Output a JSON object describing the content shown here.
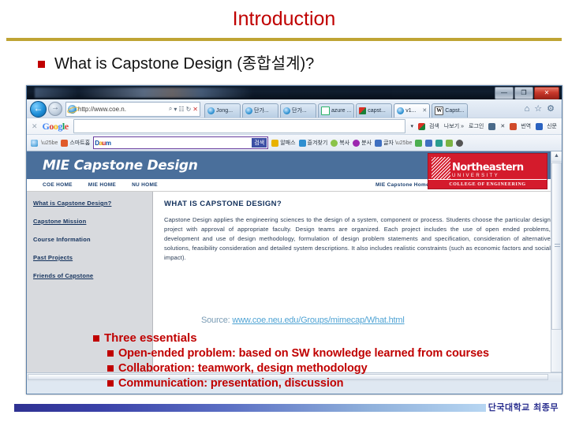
{
  "slide": {
    "title": "Introduction",
    "accent_rule_color": "#BFA434",
    "title_color": "#C00000",
    "main_bullet": "What is Capstone Design (종합설계)?"
  },
  "browser": {
    "window_title": "",
    "window_buttons": {
      "minimize": "—",
      "maximize": "❐",
      "close": "✕"
    },
    "back_icon": "←",
    "forward_icon": "→",
    "address": {
      "url": "http://www.coe.n.",
      "search_icon": "⌕",
      "dropdown_icon": "▾",
      "compat_icon": "☷",
      "refresh_icon": "↻",
      "stop_icon": "✕"
    },
    "tabs": [
      {
        "label": "Jong...",
        "icon": "ie-icon",
        "active": false,
        "closable": false
      },
      {
        "label": "단가...",
        "icon": "ie-icon",
        "active": false,
        "closable": false
      },
      {
        "label": "단가...",
        "icon": "ie-icon",
        "active": false,
        "closable": false
      },
      {
        "label": "azure ...",
        "icon": "window-icon",
        "active": false,
        "closable": false
      },
      {
        "label": "capst...",
        "icon": "google-icon",
        "active": false,
        "closable": false
      },
      {
        "label": "v1...",
        "icon": "ie-icon",
        "active": true,
        "closable": true
      },
      {
        "label": "Capst...",
        "icon": "wikipedia-icon",
        "active": false,
        "closable": false
      }
    ],
    "tab_close_glyph": "✕",
    "nav_icons": [
      {
        "name": "home-icon",
        "glyph": "⌂"
      },
      {
        "name": "favorites-star-icon",
        "glyph": "☆"
      },
      {
        "name": "settings-gear-icon",
        "glyph": "⚙"
      }
    ],
    "google_bar": {
      "close_glyph": "✕",
      "logo_letters": [
        "G",
        "o",
        "o",
        "g",
        "l",
        "e"
      ],
      "search_value": "",
      "search_placeholder": "",
      "dropdown_glyph": "▾",
      "items": [
        {
          "name": "search-menu",
          "label": "검색",
          "color": "#3a7bd5"
        },
        {
          "name": "more-menu",
          "label": "나보기 »",
          "color": "#888888"
        },
        {
          "name": "login-link",
          "label": "로그인",
          "color": "#666666"
        },
        {
          "name": "tools-menu",
          "label": "",
          "color": "#4a6a8a"
        },
        {
          "name": "close-x",
          "label": "✕",
          "color": "#777777"
        },
        {
          "name": "translate-menu",
          "label": "번역",
          "color": "#d04a2a"
        },
        {
          "name": "news-menu",
          "label": "신문",
          "color": "#2a62c0"
        }
      ]
    },
    "daum_bar": {
      "logo": [
        "D",
        "a",
        "u",
        "m"
      ],
      "home_label": "스마트홈",
      "search_value": "",
      "search_button": "검색",
      "items": [
        {
          "name": "alpass-item",
          "label": "알패스",
          "color": "#e8b200"
        },
        {
          "name": "favorites-item",
          "label": "즐겨찾기",
          "color": "#2f8fd0"
        },
        {
          "name": "capture-item",
          "label": "복사",
          "color": "#8bc34a"
        },
        {
          "name": "search-item",
          "label": "분사",
          "color": "#9c27b0"
        },
        {
          "name": "font-item",
          "label": "글자",
          "color": "#3f6fc0"
        },
        {
          "name": "clean-item",
          "label": "",
          "color": "#4caf50"
        },
        {
          "name": "save-item",
          "label": "",
          "color": "#3f6fc0"
        },
        {
          "name": "calendar-item",
          "label": "",
          "color": "#2a9d8f"
        },
        {
          "name": "memo-item",
          "label": "",
          "color": "#7cb342"
        },
        {
          "name": "settings-item",
          "label": "",
          "color": "#555555"
        }
      ]
    }
  },
  "webpage": {
    "brand": "MIE Capstone Design",
    "nu_logo": {
      "line1": "Northeastern",
      "line2": "UNIVERSITY",
      "line3": "COLLEGE OF ENGINEERING"
    },
    "topnav": [
      {
        "label": "COE HOME",
        "align": "left"
      },
      {
        "label": "MIE HOME",
        "align": "left"
      },
      {
        "label": "NU HOME",
        "align": "left"
      },
      {
        "label": "MIE Capstone Home",
        "align": "right"
      }
    ],
    "sidebar": [
      {
        "label": "What is Capstone Design?",
        "linked": true
      },
      {
        "label": "Capstone Mission",
        "linked": true
      },
      {
        "label": "Course Information",
        "linked": false
      },
      {
        "label": "Past Projects",
        "linked": true
      },
      {
        "label": "Friends of Capstone",
        "linked": true
      }
    ],
    "heading": "WHAT IS CAPSTONE DESIGN?",
    "body": "Capstone Design applies the engineering sciences to the design of a system, component or process. Students choose the particular design project with approval of appropriate faculty. Design teams are organized. Each project includes the use of open ended problems, development and use of design methodology, formulation of design problem statements and specification, consideration of alternative solutions, feasibility consideration and detailed system descriptions. It also includes realistic constraints (such as economic factors and social impact).",
    "scroll_up_glyph": "▲",
    "scroll_down_glyph": "▼"
  },
  "source": {
    "label": "Source: ",
    "url": "www.coe.neu.edu/Groups/mimecap/What.html"
  },
  "essentials": {
    "heading": "Three essentials",
    "items": [
      "Open-ended problem: based on SW knowledge learned from courses",
      "Collaboration: teamwork, design methodology",
      "Communication: presentation, discussion"
    ],
    "color": "#C00000"
  },
  "footer": {
    "text": "단국대학교 최종무",
    "bar_from": "#2e3192",
    "bar_to": "#b7d6f2"
  }
}
